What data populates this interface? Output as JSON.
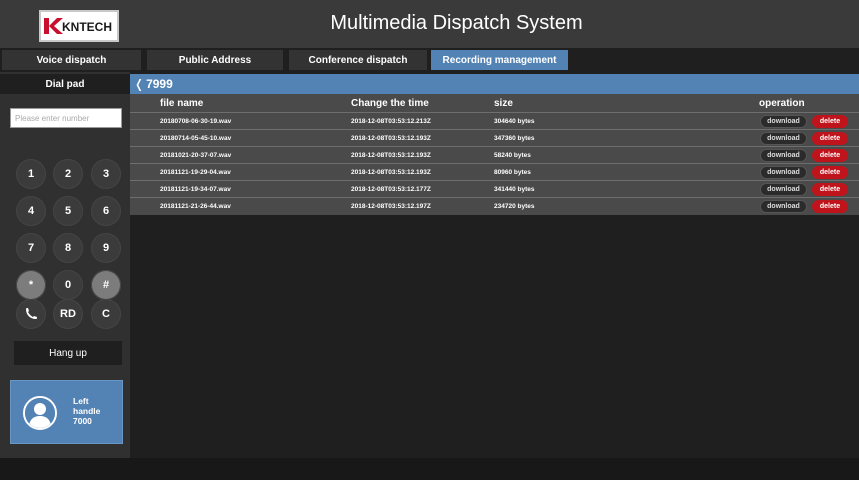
{
  "header": {
    "logo_text": "KNTECH",
    "title": "Multimedia Dispatch System"
  },
  "tabs": [
    {
      "label": "Voice dispatch",
      "active": false
    },
    {
      "label": "Public Address",
      "active": false
    },
    {
      "label": "Conference dispatch",
      "active": false
    },
    {
      "label": "Recording management",
      "active": true
    }
  ],
  "sidebar": {
    "title": "Dial pad",
    "number_placeholder": "Please enter number",
    "keys": [
      "1",
      "2",
      "3",
      "4",
      "5",
      "6",
      "7",
      "8",
      "9",
      "*",
      "0",
      "#",
      "call",
      "RD",
      "C"
    ],
    "hangup_label": "Hang up",
    "handle": {
      "line1": "Left",
      "line2": "handle",
      "line3": "7000"
    }
  },
  "breadcrumb": {
    "label": "7999"
  },
  "table": {
    "columns": [
      "file name",
      "Change the time",
      "size",
      "operation"
    ],
    "download_label": "download",
    "delete_label": "delete",
    "rows": [
      {
        "file": "20180708-06-30-19.wav",
        "time": "2018-12-08T03:53:12.213Z",
        "size": "304640 bytes"
      },
      {
        "file": "20180714-05-45-10.wav",
        "time": "2018-12-08T03:53:12.193Z",
        "size": "347360 bytes"
      },
      {
        "file": "20181021-20-37-07.wav",
        "time": "2018-12-08T03:53:12.193Z",
        "size": "58240 bytes"
      },
      {
        "file": "20181121-19-29-04.wav",
        "time": "2018-12-08T03:53:12.193Z",
        "size": "80960 bytes"
      },
      {
        "file": "20181121-19-34-07.wav",
        "time": "2018-12-08T03:53:12.177Z",
        "size": "341440 bytes"
      },
      {
        "file": "20181121-21-26-44.wav",
        "time": "2018-12-08T03:53:12.197Z",
        "size": "234720 bytes"
      }
    ]
  },
  "colors": {
    "accent": "#5383b5",
    "delete": "#c0141c",
    "logo_red": "#c8102e"
  }
}
